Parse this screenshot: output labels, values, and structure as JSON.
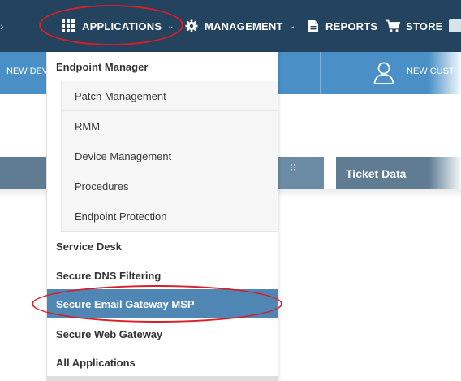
{
  "topbar": {
    "background": "#23435f",
    "items": [
      {
        "label": "APPLICATIONS",
        "icon": "grid-icon"
      },
      {
        "label": "MANAGEMENT",
        "icon": "gear-icon"
      },
      {
        "label": "REPORTS",
        "icon": "document-icon"
      },
      {
        "label": "STORE",
        "icon": "cart-icon"
      }
    ]
  },
  "subbar": {
    "background": "#4a90c6",
    "new_device_label": "NEW DEV",
    "new_customer_label": "NEW CUST",
    "customer_icon": "user-icon"
  },
  "panel": {
    "grip_icon": "grip-icon",
    "ticket_data_label": "Ticket Data"
  },
  "dropdown": {
    "group_label": "Endpoint Manager",
    "sub_items": [
      {
        "label": "Patch Management"
      },
      {
        "label": "RMM"
      },
      {
        "label": "Device Management"
      },
      {
        "label": "Procedures"
      },
      {
        "label": "Endpoint Protection"
      }
    ],
    "items": [
      {
        "label": "Service Desk"
      },
      {
        "label": "Secure DNS Filtering"
      },
      {
        "label": "Secure Email Gateway MSP",
        "selected": true
      },
      {
        "label": "Secure Web Gateway"
      },
      {
        "label": "All Applications"
      }
    ],
    "selected_color": "#4f86b4"
  },
  "annotation_color": "#d61f26"
}
